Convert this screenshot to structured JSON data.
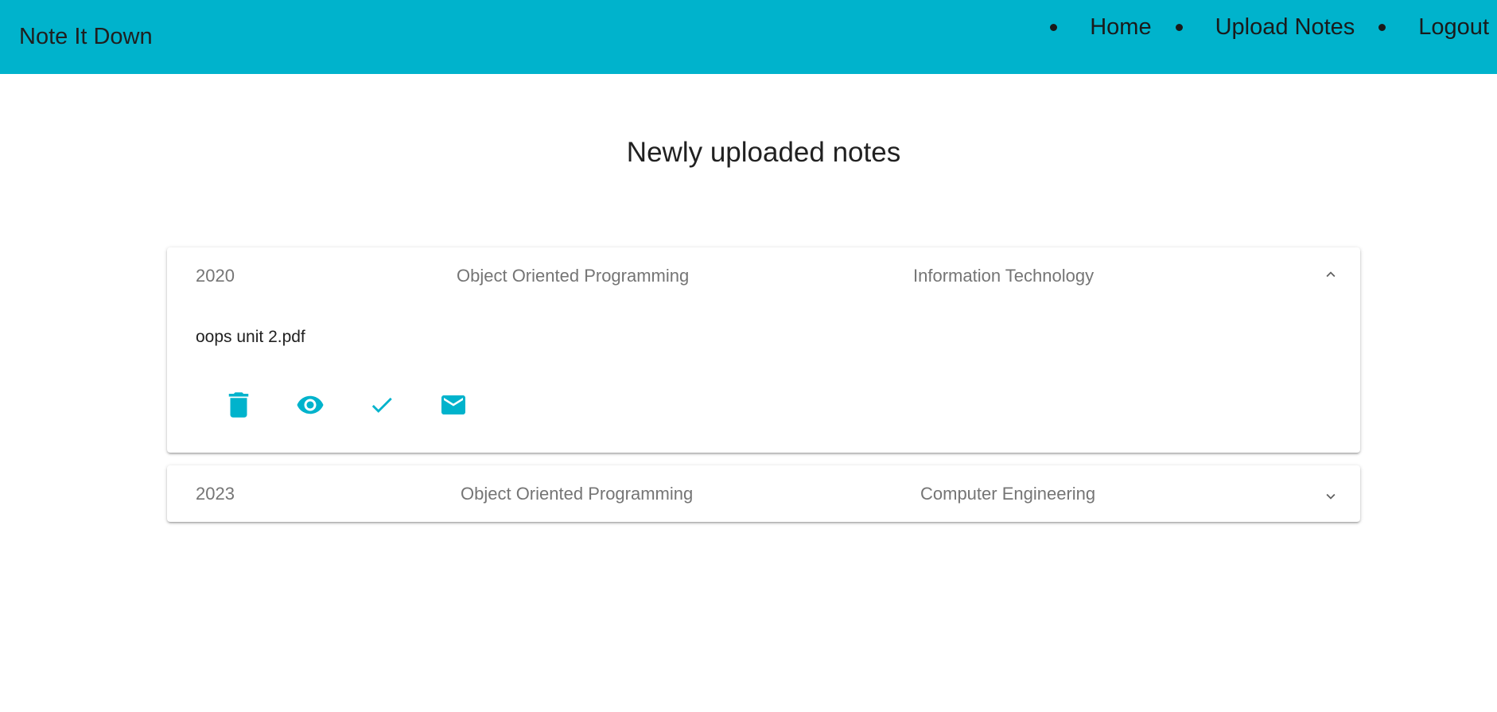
{
  "navbar": {
    "brand": "Note It Down",
    "links": [
      {
        "label": "Home"
      },
      {
        "label": "Upload Notes"
      },
      {
        "label": "Logout"
      }
    ],
    "background_color": "#00b3cc"
  },
  "main": {
    "title": "Newly uploaded notes",
    "notes": [
      {
        "year": "2020",
        "subject": "Object Oriented Programming",
        "branch": "Information Technology",
        "expanded": true,
        "file_name": "oops unit 2.pdf",
        "actions": [
          "delete-icon",
          "view-icon",
          "approve-icon",
          "email-icon"
        ]
      },
      {
        "year": "2023",
        "subject": "Object Oriented Programming",
        "branch": "Computer Engineering",
        "expanded": false
      }
    ]
  },
  "colors": {
    "accent": "#00b3cc",
    "muted_text": "#757575"
  }
}
